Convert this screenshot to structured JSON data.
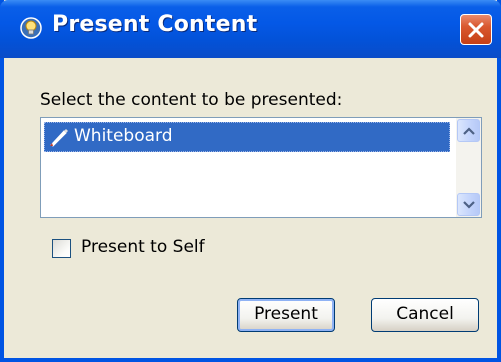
{
  "window": {
    "title": "Present Content",
    "title_icon": "help-bulb-icon",
    "close_icon": "close-x-icon"
  },
  "content": {
    "prompt": "Select the content to be presented:",
    "list": {
      "items": [
        {
          "label": "Whiteboard",
          "icon": "pen-icon",
          "selected": true
        }
      ]
    },
    "present_to_self": {
      "label": "Present to Self",
      "checked": false
    }
  },
  "buttons": {
    "present": "Present",
    "cancel": "Cancel"
  },
  "colors": {
    "titlebar": "#0458e6",
    "selection": "#316ac5",
    "close_button": "#d9582f",
    "dialog_bg": "#ece9d8"
  }
}
